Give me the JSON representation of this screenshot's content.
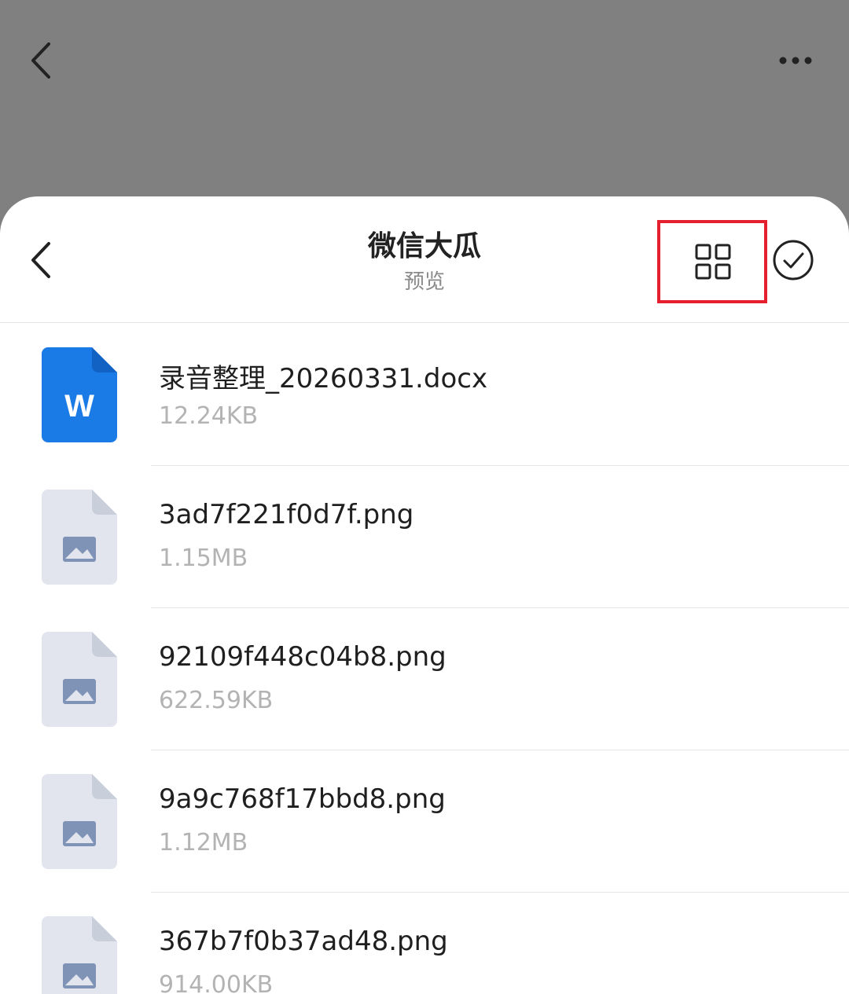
{
  "top_bar": {
    "back_icon": "chevron-left-icon",
    "more_icon": "more-horizontal-icon"
  },
  "sheet": {
    "title": "微信大瓜",
    "subtitle": "预览",
    "back_icon": "chevron-left-icon",
    "grid_view_icon": "grid-view-icon",
    "select_icon": "check-circle-icon",
    "highlight_color": "#e5202e"
  },
  "files": [
    {
      "name": "录音整理_20260331.docx",
      "size": "12.24KB",
      "type": "word",
      "icon_letter": "W"
    },
    {
      "name": "3ad7f221f0d7f.png",
      "size": "1.15MB",
      "type": "image"
    },
    {
      "name": "92109f448c04b8.png",
      "size": "622.59KB",
      "type": "image"
    },
    {
      "name": "9a9c768f17bbd8.png",
      "size": "1.12MB",
      "type": "image"
    },
    {
      "name": "367b7f0b37ad48.png",
      "size": "914.00KB",
      "type": "image"
    }
  ],
  "colors": {
    "word_icon": "#1b7be6",
    "image_icon": "#e2e5ee",
    "image_glyph": "#7f93b7"
  }
}
